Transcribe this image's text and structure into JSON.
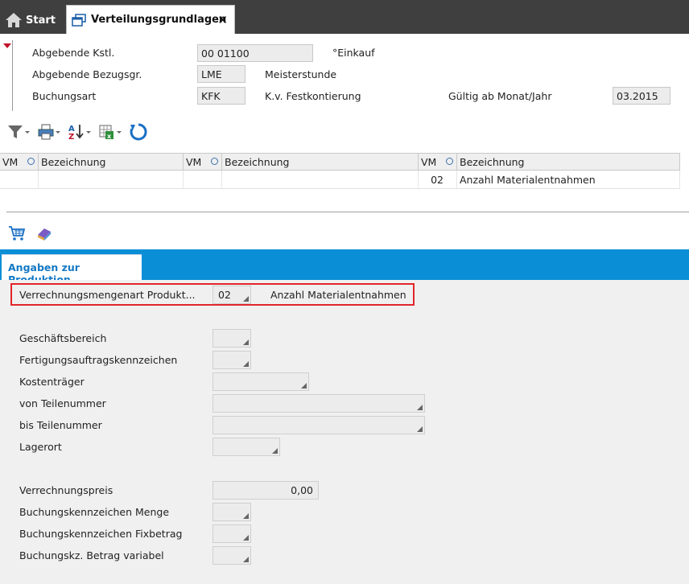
{
  "tabs": {
    "start_label": "Start",
    "active_label": "Verteilungsgrundlagen"
  },
  "header": {
    "rows": [
      {
        "label": "Abgebende Kstl.",
        "value": "00 01100",
        "desc": "°Einkauf"
      },
      {
        "label": "Abgebende Bezugsgr.",
        "value": "LME",
        "desc": "Meisterstunde"
      },
      {
        "label": "Buchungsart",
        "value": "KFK",
        "desc": "K.v. Festkontierung"
      }
    ],
    "valid_label": "Gültig ab Monat/Jahr",
    "valid_value": "03.2015"
  },
  "table": {
    "headers": [
      "VM",
      "Bezeichnung",
      "VM",
      "Bezeichnung",
      "VM",
      "Bezeichnung"
    ],
    "row": [
      "",
      "",
      "",
      "",
      "02",
      "Anzahl Materialentnahmen"
    ]
  },
  "production_tab": {
    "label": "Angaben zur Produktion"
  },
  "production": {
    "vm_label": "Verrechnungsmengenart Produkt...",
    "vm_value": "02",
    "vm_desc": "Anzahl Materialentnahmen",
    "fields": [
      {
        "label": "Geschäftsbereich",
        "value": ""
      },
      {
        "label": "Fertigungsauftragskennzeichen",
        "value": ""
      },
      {
        "label": "Kostenträger",
        "value": ""
      },
      {
        "label": "von Teilenummer",
        "value": ""
      },
      {
        "label": "bis Teilenummer",
        "value": ""
      },
      {
        "label": "Lagerort",
        "value": ""
      }
    ],
    "booking": [
      {
        "label": "Verrechnungspreis",
        "value": "0,00"
      },
      {
        "label": "Buchungskennzeichen Menge",
        "value": ""
      },
      {
        "label": "Buchungskennzeichen Fixbetrag",
        "value": ""
      },
      {
        "label": "Buchungskz. Betrag variabel",
        "value": ""
      }
    ]
  },
  "colors": {
    "tabbar": "#3f3f3f",
    "accent_blue": "#0a8fd6",
    "highlight_red": "#e2252b"
  }
}
